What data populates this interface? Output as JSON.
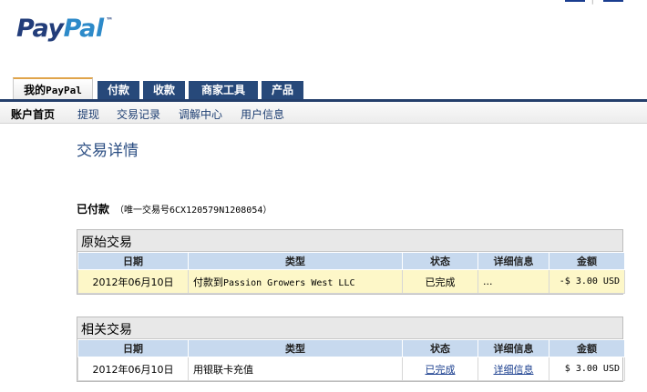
{
  "brand": {
    "pay": "Pay",
    "pal": "Pal",
    "tm": "™"
  },
  "top_links": {
    "separator": "|"
  },
  "tabs": [
    {
      "label": "我的",
      "label_suffix": "PayPal",
      "active": true
    },
    {
      "label": "付款"
    },
    {
      "label": "收款"
    },
    {
      "label": "商家工具"
    },
    {
      "label": "产品"
    }
  ],
  "subnav": [
    "账户首页",
    "提现",
    "交易记录",
    "调解中心",
    "用户信息"
  ],
  "page": {
    "title": "交易详情",
    "status": "已付款",
    "transaction_id": "（唯一交易号6CX120579N1208054）"
  },
  "table_headers": [
    "日期",
    "类型",
    "状态",
    "详细信息",
    "金额"
  ],
  "original": {
    "title": "原始交易",
    "row": {
      "date": "2012年06月10日",
      "type_prefix": "付款到",
      "type_name": "Passion Growers West LLC",
      "status": "已完成",
      "details": "...",
      "amount": "-$ 3.00 USD"
    }
  },
  "related": {
    "title": "相关交易",
    "row": {
      "date": "2012年06月10日",
      "type": "用银联卡充值",
      "status": "已完成",
      "details": "详细信息",
      "amount": "$ 3.00 USD"
    }
  }
}
